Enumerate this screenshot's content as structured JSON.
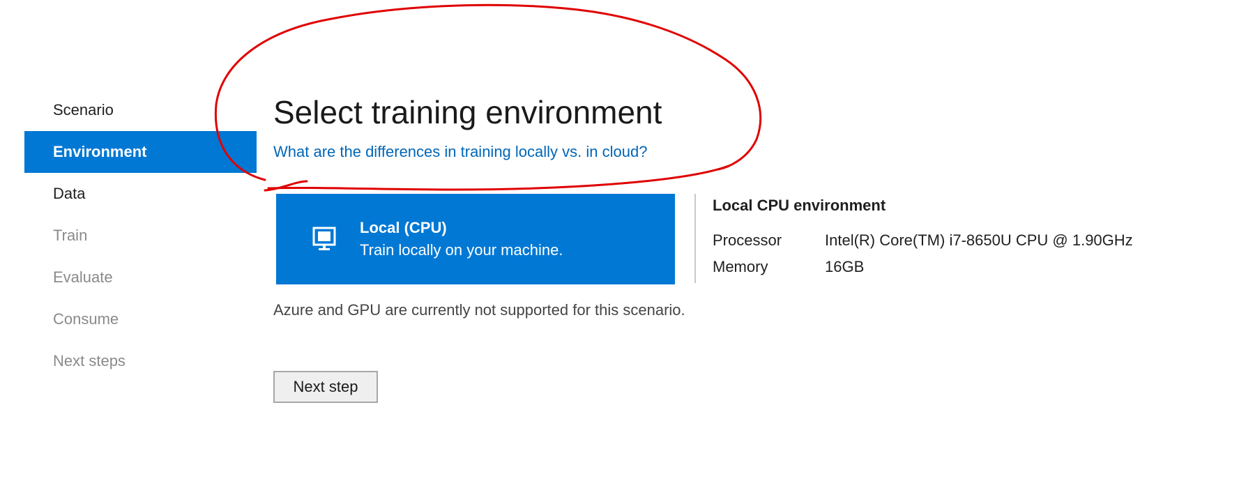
{
  "sidebar": {
    "items": [
      {
        "label": "Scenario",
        "state": "normal"
      },
      {
        "label": "Environment",
        "state": "active"
      },
      {
        "label": "Data",
        "state": "normal"
      },
      {
        "label": "Train",
        "state": "disabled"
      },
      {
        "label": "Evaluate",
        "state": "disabled"
      },
      {
        "label": "Consume",
        "state": "disabled"
      },
      {
        "label": "Next steps",
        "state": "disabled"
      }
    ]
  },
  "main": {
    "title": "Select training environment",
    "help_link": "What are the differences in training locally vs. in cloud?",
    "environment_card": {
      "icon": "monitor-icon",
      "title": "Local (CPU)",
      "description": "Train locally on your machine."
    },
    "details": {
      "title": "Local CPU environment",
      "rows": [
        {
          "label": "Processor",
          "value": "Intel(R) Core(TM) i7-8650U CPU @ 1.90GHz"
        },
        {
          "label": "Memory",
          "value": "16GB"
        }
      ]
    },
    "note": "Azure and GPU are currently not supported for this scenario.",
    "next_button_label": "Next step"
  },
  "colors": {
    "accent": "#0078d4",
    "link": "#0067b8",
    "annotation": "#e00000"
  }
}
